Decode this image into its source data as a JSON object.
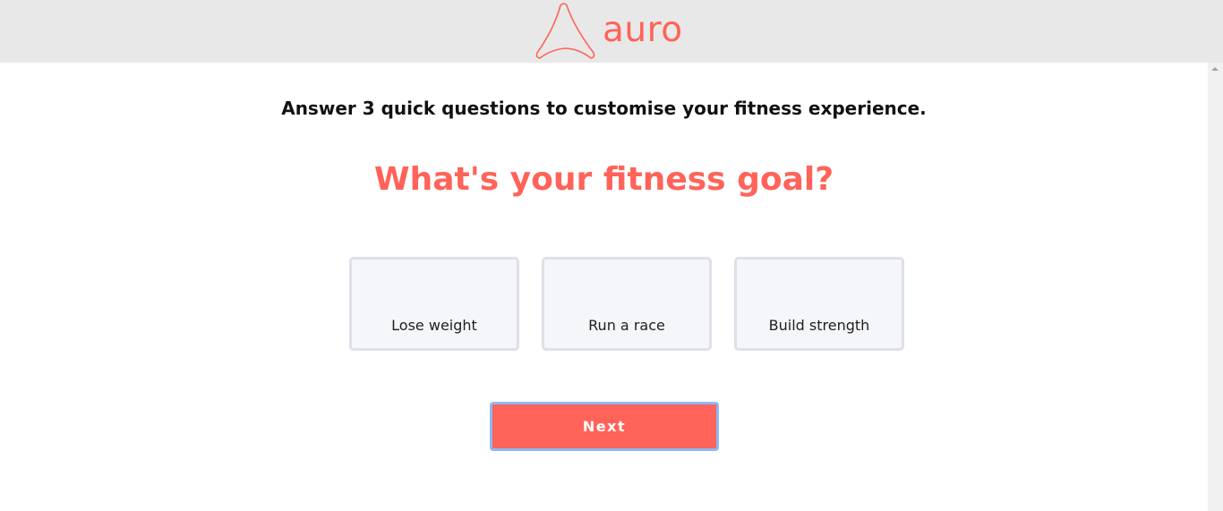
{
  "brand": {
    "name": "auro",
    "color": "#ff6359"
  },
  "intro": "Answer 3 quick questions to customise your fitness experience.",
  "question": "What's your fitness goal?",
  "options": [
    {
      "label": "Lose weight"
    },
    {
      "label": "Run a race"
    },
    {
      "label": "Build strength"
    }
  ],
  "next_label": "Next"
}
